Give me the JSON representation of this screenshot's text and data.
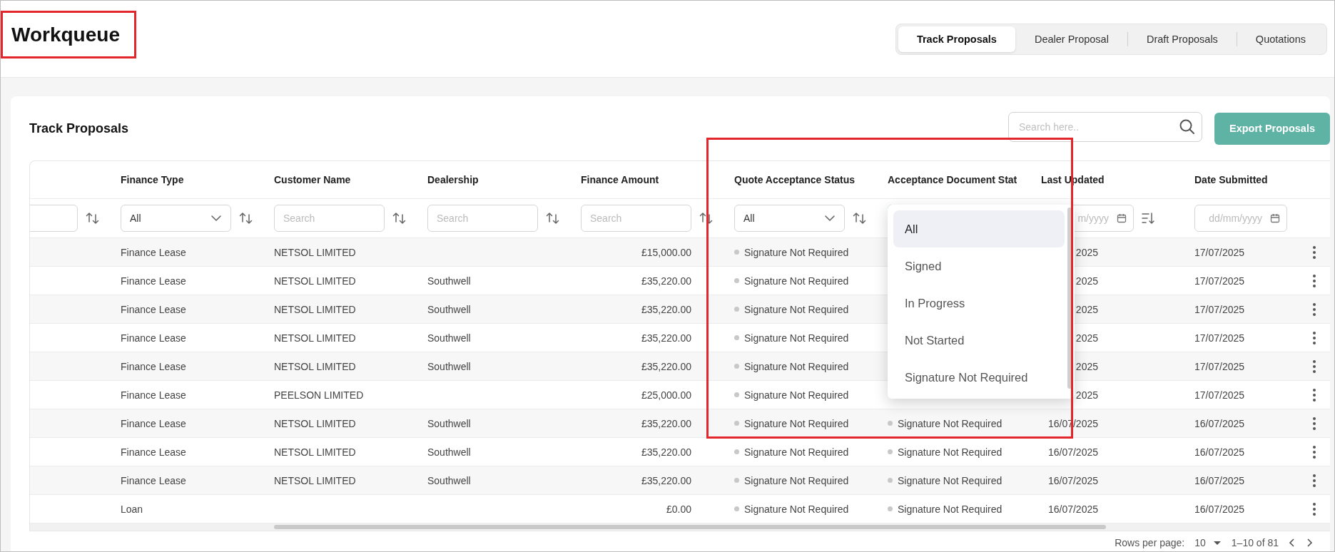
{
  "title": "Workqueue",
  "title_highlighted": true,
  "tabs": [
    {
      "label": "Track Proposals",
      "selected": true
    },
    {
      "label": "Dealer Proposal",
      "selected": false
    },
    {
      "label": "Draft Proposals",
      "selected": false
    },
    {
      "label": "Quotations",
      "selected": false
    }
  ],
  "panel": {
    "title": "Track Proposals",
    "search": {
      "placeholder": "Search here.."
    },
    "export_button": "Export Proposals"
  },
  "table": {
    "status_columns_highlighted": true,
    "columns": [
      {
        "filter": {
          "kind": "input"
        },
        "sortable": true,
        "sort_descending": false
      },
      {
        "label": "Finance Type",
        "kind": "text",
        "filter": {
          "kind": "select",
          "value": "All"
        },
        "sortable": true,
        "sort_descending": false
      },
      {
        "label": "Customer Name",
        "kind": "text",
        "filter": {
          "kind": "input",
          "placeholder": "Search"
        },
        "sortable": true,
        "sort_descending": false
      },
      {
        "label": "Dealership",
        "kind": "text",
        "filter": {
          "kind": "input",
          "placeholder": "Search"
        },
        "sortable": true,
        "sort_descending": false
      },
      {
        "label": "Finance Amount",
        "kind": "amount",
        "filter": {
          "kind": "input",
          "placeholder": "Search"
        },
        "sortable": true,
        "sort_descending": false
      },
      {
        "label": "Quote Acceptance Status",
        "kind": "status",
        "filter": {
          "kind": "select",
          "value": "All"
        },
        "sortable": true,
        "sort_descending": false
      },
      {
        "label": "Acceptance Document Stat",
        "kind": "status",
        "filter": {
          "kind": "select",
          "open": true
        },
        "sortable": false
      },
      {
        "label": "Last Updated",
        "kind": "date",
        "filter": {
          "kind": "date",
          "placeholder": "m/yyyy"
        },
        "sortable": true,
        "sort_descending": true
      },
      {
        "label": "Date Submitted",
        "kind": "text",
        "filter": {
          "kind": "date",
          "placeholder": "dd/mm/yyyy"
        },
        "sortable": false
      }
    ],
    "dropdown": {
      "options": [
        {
          "label": "All",
          "selected": true
        },
        {
          "label": "Signed",
          "selected": false
        },
        {
          "label": "In Progress",
          "selected": false
        },
        {
          "label": "Not Started",
          "selected": false
        },
        {
          "label": "Signature Not Required",
          "selected": false
        }
      ]
    },
    "rows": [
      {
        "cells": [
          null,
          "Finance Lease",
          "NETSOL LIMITED",
          null,
          "£15,000.00",
          "Signature Not Required",
          null,
          "2025",
          "17/07/2025"
        ]
      },
      {
        "cells": [
          null,
          "Finance Lease",
          "NETSOL LIMITED",
          "Southwell",
          "£35,220.00",
          "Signature Not Required",
          null,
          "2025",
          "17/07/2025"
        ]
      },
      {
        "cells": [
          null,
          "Finance Lease",
          "NETSOL LIMITED",
          "Southwell",
          "£35,220.00",
          "Signature Not Required",
          null,
          "2025",
          "17/07/2025"
        ]
      },
      {
        "cells": [
          null,
          "Finance Lease",
          "NETSOL LIMITED",
          "Southwell",
          "£35,220.00",
          "Signature Not Required",
          null,
          "2025",
          "17/07/2025"
        ]
      },
      {
        "cells": [
          null,
          "Finance Lease",
          "NETSOL LIMITED",
          "Southwell",
          "£35,220.00",
          "Signature Not Required",
          null,
          "2025",
          "17/07/2025"
        ]
      },
      {
        "cells": [
          null,
          "Finance Lease",
          "PEELSON LIMITED",
          null,
          "£25,000.00",
          "Signature Not Required",
          null,
          "2025",
          "17/07/2025"
        ]
      },
      {
        "cells": [
          null,
          "Finance Lease",
          "NETSOL LIMITED",
          "Southwell",
          "£35,220.00",
          "Signature Not Required",
          "Signature Not Required",
          "16/07/2025",
          "16/07/2025"
        ]
      },
      {
        "cells": [
          null,
          "Finance Lease",
          "NETSOL LIMITED",
          "Southwell",
          "£35,220.00",
          "Signature Not Required",
          "Signature Not Required",
          "16/07/2025",
          "16/07/2025"
        ]
      },
      {
        "cells": [
          null,
          "Finance Lease",
          "NETSOL LIMITED",
          "Southwell",
          "£35,220.00",
          "Signature Not Required",
          "Signature Not Required",
          "16/07/2025",
          "16/07/2025"
        ]
      },
      {
        "cells": [
          null,
          "Loan",
          null,
          null,
          "£0.00",
          "Signature Not Required",
          "Signature Not Required",
          "16/07/2025",
          "16/07/2025"
        ]
      }
    ]
  },
  "pagination": {
    "rows_per_page_label": "Rows per page:",
    "rows_per_page": "10",
    "range": "1–10 of 81"
  }
}
